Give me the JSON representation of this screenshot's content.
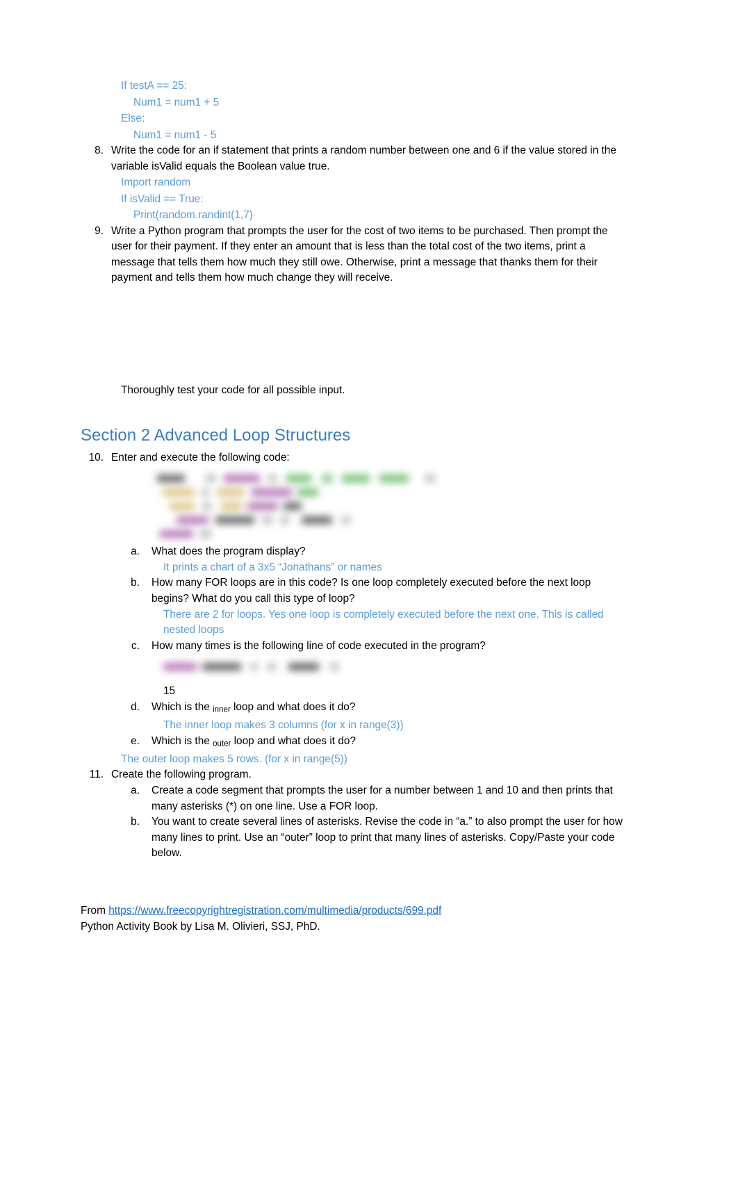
{
  "document": {
    "code_block_7": [
      {
        "text": "If testA == 25:",
        "indent": 0
      },
      {
        "text": "Num1 = num1 + 5",
        "indent": 1
      },
      {
        "text": "Else:",
        "indent": 0
      },
      {
        "text": "Num1 = num1 - 5",
        "indent": 1
      }
    ],
    "item8": {
      "marker": "8.",
      "text": "Write the code for an if statement that prints a random number between one and 6 if the value stored in the variable isValid equals the Boolean value true.",
      "answer_lines": [
        {
          "text": "Import random",
          "indent": 0
        },
        {
          "text": "If isValid == True:",
          "indent": 0
        },
        {
          "text": "Print(random.randint(1,7)",
          "indent": 1
        }
      ]
    },
    "item9": {
      "marker": "9.",
      "text": "Write a Python program that prompts the user for the cost of two items to be purchased. Then prompt the user for their payment. If they enter an amount that is less than the total cost of the two items, print a message that tells them how much they still owe. Otherwise, print a message that thanks them for their payment and tells them how much change they will receive."
    },
    "thoroughly_test": "Thoroughly test your code for all possible input.",
    "section2": {
      "heading": "Section 2 Advanced Loop Structures"
    },
    "item10": {
      "marker": "10.",
      "text": "Enter and execute the following code:",
      "code_redacted": true,
      "subitems": [
        {
          "marker": "a.",
          "question": "What does the program display?",
          "answer": "It prints a chart of a 3x5 “Jonathans” or names"
        },
        {
          "marker": "b.",
          "question": "How many FOR loops are in this code? Is one loop completely executed before the next loop begins? What do you call this type of loop?",
          "answer": "There are 2 for loops. Yes one loop is completely executed before the next one. This is called nested loops"
        },
        {
          "marker": "c.",
          "question": "How many times is the following line of code executed in the program?",
          "code_redacted": true,
          "answer_plain": "15"
        },
        {
          "marker": "d.",
          "question_pre": "Which is the ",
          "question_sub": "inner",
          "question_post": " loop and what does it do?",
          "answer": "The inner loop makes 3 columns (for x in range(3))"
        },
        {
          "marker": "e.",
          "question_pre": "Which is the ",
          "question_sub": "outer",
          "question_post": " loop and what does it do?",
          "answer": "The outer loop makes 5 rows. (for x in range(5))"
        }
      ]
    },
    "item11": {
      "marker": "11.",
      "text": "Create the following program.",
      "subitems": [
        {
          "marker": "a.",
          "question": "Create a code segment that prompts the user for a number between 1 and 10 and then prints that many asterisks (*) on one line. Use a FOR loop."
        },
        {
          "marker": "b.",
          "question": "You want to create several lines of asterisks. Revise the code in “a.” to also prompt the user for how many lines to print. Use an “outer” loop to print that many lines of asterisks. Copy/Paste your code below."
        }
      ]
    },
    "footer": {
      "from_label": "From ",
      "url": "https://www.freecopyrightregistration.com/multimedia/products/699.pdf",
      "attribution": "Python Activity Book by Lisa M. Olivieri, SSJ, PhD."
    }
  },
  "colors": {
    "accent_blue": "#5B9BD5",
    "heading_blue": "#3C7CBE",
    "link_blue": "#1F6FC4",
    "body_black": "#000000"
  }
}
